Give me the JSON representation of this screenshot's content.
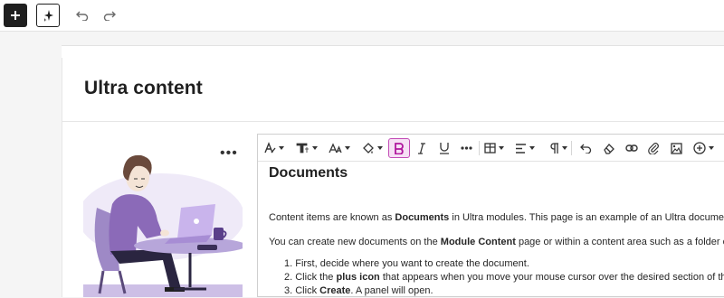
{
  "toolbar_top": {
    "add_icon": "plus-icon",
    "ai_icon": "sparkle-icon",
    "undo_icon": "undo-icon",
    "redo_icon": "redo-icon"
  },
  "page": {
    "title": "Ultra content"
  },
  "image_block": {
    "more_label": "•••",
    "illustration": "person-with-laptop-illustration"
  },
  "editor": {
    "toolbar": [
      {
        "name": "text-style-icon",
        "dropdown": true
      },
      {
        "name": "heading-format-icon",
        "dropdown": true
      },
      {
        "name": "font-size-icon",
        "dropdown": true
      },
      {
        "name": "highlight-color-icon",
        "dropdown": true
      },
      {
        "name": "bold-icon",
        "active": true
      },
      {
        "name": "italic-icon"
      },
      {
        "name": "underline-icon"
      },
      {
        "name": "more-icon"
      },
      {
        "name": "table-icon",
        "dropdown": true
      },
      {
        "name": "align-icon",
        "dropdown": true
      },
      {
        "name": "paragraph-icon",
        "dropdown": true
      },
      {
        "name": "undo-icon"
      },
      {
        "name": "clear-format-icon"
      },
      {
        "name": "link-icon"
      },
      {
        "name": "attach-icon"
      },
      {
        "name": "insert-image-icon"
      },
      {
        "name": "add-content-icon",
        "dropdown": true
      }
    ],
    "heading": "Documents",
    "p1_a": "Content items are known as ",
    "p1_b": "Documents",
    "p1_c": " in Ultra modules. This page is an example of an Ultra document.",
    "p2_a": "You can create new documents on the ",
    "p2_b": "Module Content",
    "p2_c": " page or within a content area such as a folder or learni",
    "list": [
      {
        "n": "1. ",
        "a": "First, decide where you want to create the document.",
        "b": "",
        "c": ""
      },
      {
        "n": "2. ",
        "a": "Click the ",
        "b": "plus icon",
        "c": " that appears when you move your mouse cursor over the desired section of the page."
      },
      {
        "n": "3. ",
        "a": "Click ",
        "b": "Create",
        "c": ". A panel will open."
      }
    ]
  },
  "colors": {
    "accent": "#b0169d",
    "accent_bg": "#f6e0f4",
    "dark": "#1f1f1f"
  }
}
